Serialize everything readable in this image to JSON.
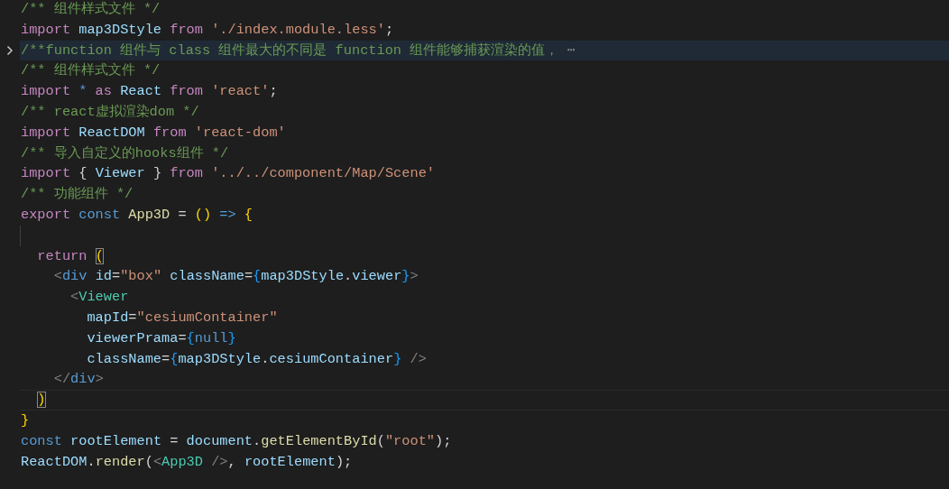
{
  "editor": {
    "lines": [
      {
        "tokens": [
          {
            "text": "/** 组件样式文件 */",
            "kind": "comment"
          }
        ]
      },
      {
        "tokens": [
          {
            "text": "import",
            "kind": "keyword"
          },
          {
            "text": " map3DStyle",
            "kind": "variable"
          },
          {
            "text": " from",
            "kind": "keyword"
          },
          {
            "text": " './index.module.less'",
            "kind": "string"
          },
          {
            "text": ";",
            "kind": "plain"
          }
        ]
      },
      {
        "selected": true,
        "folded": true,
        "tokens": [
          {
            "text": "/**function 组件与 class 组件最大的不同是 function 组件能够捕获渲染的值，",
            "kind": "comment"
          },
          {
            "text": " ⋯",
            "kind": "fold"
          }
        ]
      },
      {
        "tokens": [
          {
            "text": "/** 组件样式文件 */",
            "kind": "comment"
          }
        ]
      },
      {
        "tokens": [
          {
            "text": "import",
            "kind": "keyword"
          },
          {
            "text": " *",
            "kind": "storage"
          },
          {
            "text": " as",
            "kind": "keyword"
          },
          {
            "text": " React",
            "kind": "variable"
          },
          {
            "text": " from",
            "kind": "keyword"
          },
          {
            "text": " 'react'",
            "kind": "string"
          },
          {
            "text": ";",
            "kind": "plain"
          }
        ]
      },
      {
        "tokens": [
          {
            "text": "/** react虚拟渲染dom */",
            "kind": "comment"
          }
        ]
      },
      {
        "tokens": [
          {
            "text": "import",
            "kind": "keyword"
          },
          {
            "text": " ReactDOM",
            "kind": "variable"
          },
          {
            "text": " from",
            "kind": "keyword"
          },
          {
            "text": " 'react-dom'",
            "kind": "string"
          }
        ]
      },
      {
        "tokens": [
          {
            "text": "/** 导入自定义的hooks组件 */",
            "kind": "comment"
          }
        ]
      },
      {
        "tokens": [
          {
            "text": "import",
            "kind": "keyword"
          },
          {
            "text": " { ",
            "kind": "plain"
          },
          {
            "text": "Viewer",
            "kind": "variable"
          },
          {
            "text": " } ",
            "kind": "plain"
          },
          {
            "text": "from",
            "kind": "keyword"
          },
          {
            "text": " '../../component/Map/Scene'",
            "kind": "string"
          }
        ]
      },
      {
        "tokens": [
          {
            "text": "/** 功能组件 */",
            "kind": "comment"
          }
        ]
      },
      {
        "tokens": [
          {
            "text": "export",
            "kind": "keyword"
          },
          {
            "text": " const",
            "kind": "storage"
          },
          {
            "text": " App3D",
            "kind": "function"
          },
          {
            "text": " = ",
            "kind": "plain"
          },
          {
            "text": "()",
            "kind": "bracket"
          },
          {
            "text": " =>",
            "kind": "storage"
          },
          {
            "text": " {",
            "kind": "bracket"
          }
        ]
      },
      {
        "kind": "blank"
      },
      {
        "tokens": [
          {
            "text": "  return ",
            "kind": "keyword"
          },
          {
            "text": "(",
            "kind": "match"
          }
        ]
      },
      {
        "tokens": [
          {
            "text": "    <",
            "kind": "punct"
          },
          {
            "text": "div",
            "kind": "tag"
          },
          {
            "text": " id",
            "kind": "variable"
          },
          {
            "text": "=",
            "kind": "plain"
          },
          {
            "text": "\"box\"",
            "kind": "string"
          },
          {
            "text": " className",
            "kind": "variable"
          },
          {
            "text": "=",
            "kind": "plain"
          },
          {
            "text": "{",
            "kind": "brace"
          },
          {
            "text": "map3DStyle",
            "kind": "variable"
          },
          {
            "text": ".",
            "kind": "plain"
          },
          {
            "text": "viewer",
            "kind": "variable"
          },
          {
            "text": "}",
            "kind": "brace"
          },
          {
            "text": ">",
            "kind": "punct"
          }
        ]
      },
      {
        "tokens": [
          {
            "text": "      <",
            "kind": "punct"
          },
          {
            "text": "Viewer",
            "kind": "component"
          }
        ]
      },
      {
        "tokens": [
          {
            "text": "        mapId",
            "kind": "variable"
          },
          {
            "text": "=",
            "kind": "plain"
          },
          {
            "text": "\"cesiumContainer\"",
            "kind": "string"
          }
        ]
      },
      {
        "tokens": [
          {
            "text": "        viewerPrama",
            "kind": "variable"
          },
          {
            "text": "=",
            "kind": "plain"
          },
          {
            "text": "{",
            "kind": "brace"
          },
          {
            "text": "null",
            "kind": "storage"
          },
          {
            "text": "}",
            "kind": "brace"
          }
        ]
      },
      {
        "tokens": [
          {
            "text": "        className",
            "kind": "variable"
          },
          {
            "text": "=",
            "kind": "plain"
          },
          {
            "text": "{",
            "kind": "brace"
          },
          {
            "text": "map3DStyle",
            "kind": "variable"
          },
          {
            "text": ".",
            "kind": "plain"
          },
          {
            "text": "cesiumContainer",
            "kind": "variable"
          },
          {
            "text": "}",
            "kind": "brace"
          },
          {
            "text": " />",
            "kind": "punct"
          }
        ]
      },
      {
        "tokens": [
          {
            "text": "    </",
            "kind": "punct"
          },
          {
            "text": "div",
            "kind": "tag"
          },
          {
            "text": ">",
            "kind": "punct"
          }
        ]
      },
      {
        "current": true,
        "tokens": [
          {
            "text": "  )",
            "kind": "match"
          }
        ]
      },
      {
        "tokens": [
          {
            "text": "}",
            "kind": "bracket"
          }
        ]
      },
      {
        "tokens": [
          {
            "text": "const",
            "kind": "storage"
          },
          {
            "text": " rootElement",
            "kind": "variable"
          },
          {
            "text": " = ",
            "kind": "plain"
          },
          {
            "text": "document",
            "kind": "variable"
          },
          {
            "text": ".",
            "kind": "plain"
          },
          {
            "text": "getElementById",
            "kind": "function"
          },
          {
            "text": "(",
            "kind": "plain"
          },
          {
            "text": "\"root\"",
            "kind": "string"
          },
          {
            "text": ");",
            "kind": "plain"
          }
        ]
      },
      {
        "tokens": [
          {
            "text": "ReactDOM",
            "kind": "variable"
          },
          {
            "text": ".",
            "kind": "plain"
          },
          {
            "text": "render",
            "kind": "function"
          },
          {
            "text": "(",
            "kind": "plain"
          },
          {
            "text": "<",
            "kind": "punct"
          },
          {
            "text": "App3D",
            "kind": "component"
          },
          {
            "text": " />",
            "kind": "punct"
          },
          {
            "text": ", ",
            "kind": "plain"
          },
          {
            "text": "rootElement",
            "kind": "variable"
          },
          {
            "text": ");",
            "kind": "plain"
          }
        ]
      }
    ]
  }
}
